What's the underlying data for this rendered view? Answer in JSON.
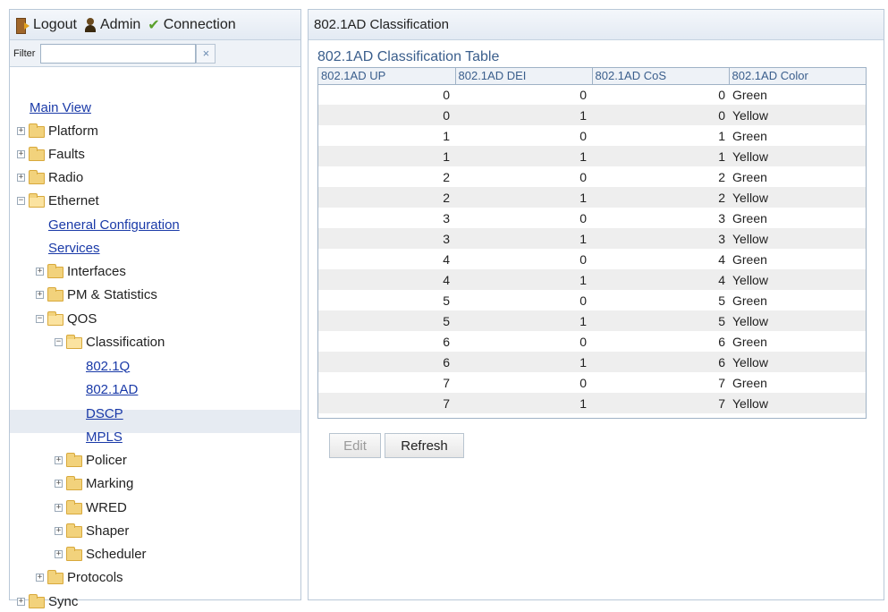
{
  "topbar": {
    "logout": "Logout",
    "admin": "Admin",
    "connection": "Connection"
  },
  "filter": {
    "label": "Filter",
    "value": "",
    "clear": "×"
  },
  "tree": {
    "main_view": "Main View",
    "platform": "Platform",
    "faults": "Faults",
    "radio": "Radio",
    "ethernet": "Ethernet",
    "general_configuration": "General Configuration",
    "services": "Services",
    "interfaces": "Interfaces",
    "pm_statistics": "PM & Statistics",
    "qos": "QOS",
    "classification": "Classification",
    "q8021q": "802.1Q",
    "q8021ad": "802.1AD",
    "dscp": "DSCP",
    "mpls": "MPLS",
    "policer": "Policer",
    "marking": "Marking",
    "wred": "WRED",
    "shaper": "Shaper",
    "scheduler": "Scheduler",
    "protocols": "Protocols",
    "sync": "Sync"
  },
  "main": {
    "header": "802.1AD Classification",
    "table_title": "802.1AD Classification Table",
    "columns": [
      "802.1AD UP",
      "802.1AD DEI",
      "802.1AD CoS",
      "802.1AD Color"
    ],
    "rows": [
      [
        "0",
        "0",
        "0",
        "Green"
      ],
      [
        "0",
        "1",
        "0",
        "Yellow"
      ],
      [
        "1",
        "0",
        "1",
        "Green"
      ],
      [
        "1",
        "1",
        "1",
        "Yellow"
      ],
      [
        "2",
        "0",
        "2",
        "Green"
      ],
      [
        "2",
        "1",
        "2",
        "Yellow"
      ],
      [
        "3",
        "0",
        "3",
        "Green"
      ],
      [
        "3",
        "1",
        "3",
        "Yellow"
      ],
      [
        "4",
        "0",
        "4",
        "Green"
      ],
      [
        "4",
        "1",
        "4",
        "Yellow"
      ],
      [
        "5",
        "0",
        "5",
        "Green"
      ],
      [
        "5",
        "1",
        "5",
        "Yellow"
      ],
      [
        "6",
        "0",
        "6",
        "Green"
      ],
      [
        "6",
        "1",
        "6",
        "Yellow"
      ],
      [
        "7",
        "0",
        "7",
        "Green"
      ],
      [
        "7",
        "1",
        "7",
        "Yellow"
      ]
    ],
    "edit_label": "Edit",
    "refresh_label": "Refresh"
  }
}
